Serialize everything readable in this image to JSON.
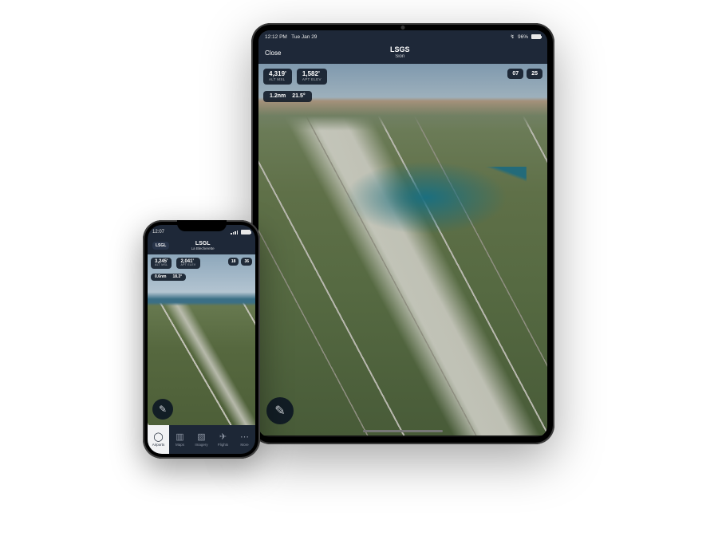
{
  "ipad": {
    "status": {
      "time": "12:12 PM",
      "date": "Tue Jan 29",
      "battery": "96%",
      "charging": "↯"
    },
    "nav": {
      "close": "Close",
      "title": "LSGS",
      "subtitle": "Sion"
    },
    "stats": {
      "altmsl": "4,319'",
      "altmsl_label": "ALT MSL",
      "aptelev": "1,582'",
      "aptelev_label": "APT ELEV",
      "dist": "1.2nm",
      "brg": "21.5°"
    },
    "runways": {
      "a": "07",
      "b": "25"
    }
  },
  "iphone": {
    "status": {
      "time": "12:07",
      "charging": "↯"
    },
    "nav": {
      "back": "LSGL",
      "title": "LSGL",
      "subtitle": "La Blecherette"
    },
    "stats": {
      "altmsl": "3,245'",
      "altmsl_label": "ALT MSL",
      "aptelev": "2,041'",
      "aptelev_label": "APT ELEV",
      "dist": "0.6nm",
      "brg": "18.3°"
    },
    "runways": {
      "a": "18",
      "b": "36"
    },
    "tabs": {
      "airports": "Airports",
      "maps": "Maps",
      "imagery": "Imagery",
      "flights": "Flights",
      "more": "More"
    }
  }
}
